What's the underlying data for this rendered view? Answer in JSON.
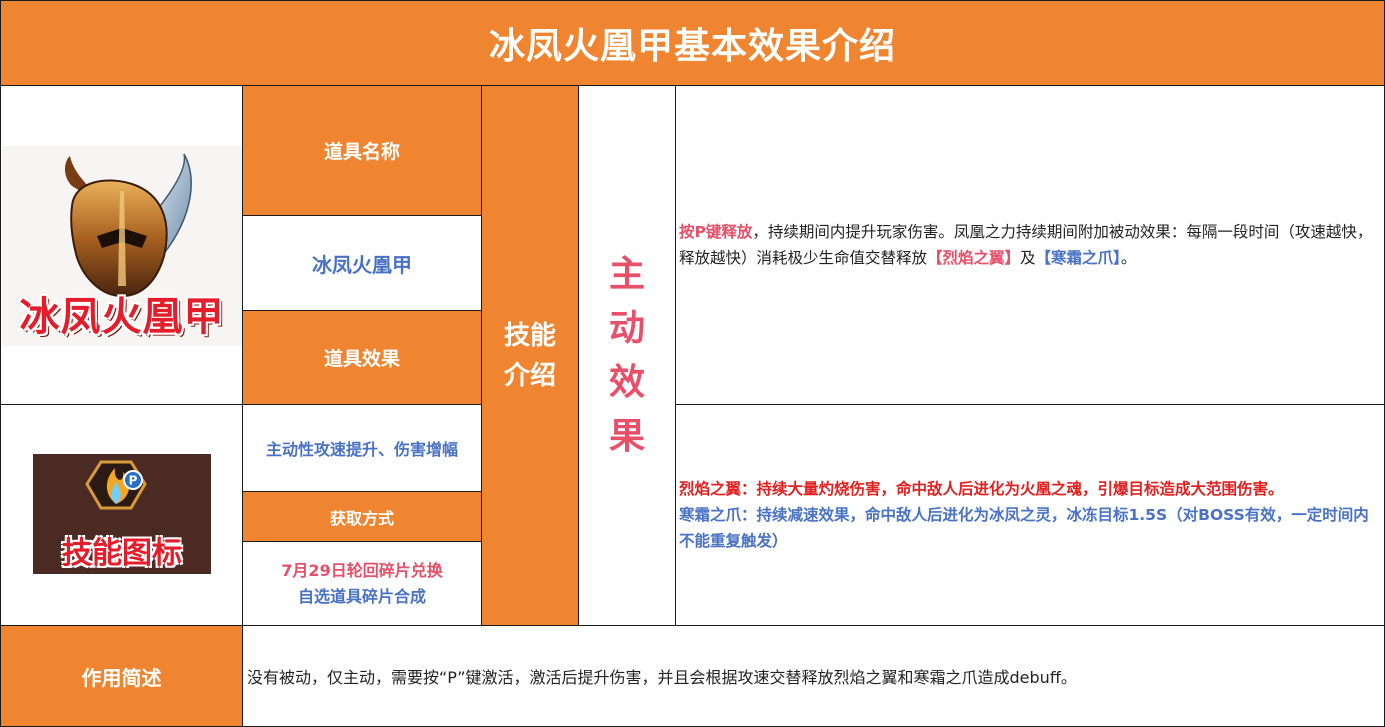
{
  "title": "冰凤火凰甲基本效果介绍",
  "images": {
    "item_art_label": "冰凤火凰甲",
    "skill_icon_label": "技能图标",
    "skill_icon_badge": "P"
  },
  "properties": {
    "name_header": "道具名称",
    "name_value": "冰凤火凰甲",
    "effect_header": "道具效果",
    "effect_value": "主动性攻速提升、伤害增幅",
    "obtain_header": "获取方式",
    "obtain_line1": "7月29日轮回碎片兑换",
    "obtain_line2": "自选道具碎片合成"
  },
  "skill_intro": {
    "line1": "技能",
    "line2": "介绍"
  },
  "active_effect": {
    "chars": [
      "主",
      "动",
      "效",
      "果"
    ]
  },
  "desc1": {
    "key": "按P键释放",
    "text_a": "，持续期间内提升玩家伤害。凤凰之力持续期间附加被动效果：每隔一段时间（攻速越快，释放越快）消耗极少生命值交替释放",
    "fire": "【烈焰之翼】",
    "and": "及",
    "frost": "【寒霜之爪】",
    "end": "。"
  },
  "desc2": {
    "fire_line": "烈焰之翼：持续大量灼烧伤害，命中敌人后进化为火凰之魂，引爆目标造成大范围伤害。",
    "frost_line": "寒霜之爪：持续减速效果，命中敌人后进化为冰凤之灵，冰冻目标1.5S（对BOSS有效，一定时间内不能重复触发）"
  },
  "summary": {
    "header": "作用简述",
    "text": "没有被动，仅主动，需要按“P”键激活，激活后提升伤害，并且会根据攻速交替释放烈焰之翼和寒霜之爪造成debuff。"
  },
  "colors": {
    "orange": "#ef8530",
    "blue_text": "#4a72c4",
    "pink_text": "#e8506a",
    "red_text": "#e22020"
  }
}
